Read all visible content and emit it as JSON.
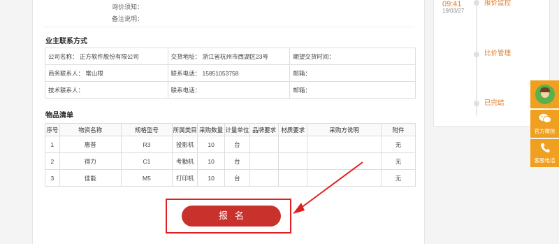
{
  "notes": {
    "price_notice_label": "询价须知：",
    "remark_label": "备注说明："
  },
  "owner_section": {
    "title": "业主联系方式",
    "rows": [
      [
        "公司名称：  正方软件股份有限公司",
        "交货地址：  浙江省杭州市西湖区23号",
        "期望交货时间："
      ],
      [
        "商务联系人：  常山根",
        "联系电话：  15851053758",
        "邮箱："
      ],
      [
        "技术联系人：",
        "联系电话：",
        "邮箱："
      ]
    ]
  },
  "items_section": {
    "title": "物品清单",
    "headers": [
      "序号",
      "物资名称",
      "规格型号",
      "所属类目",
      "采购数量",
      "计量单位",
      "品牌要求",
      "材质要求",
      "采购方说明",
      "附件"
    ],
    "rows": [
      [
        "1",
        "惠普",
        "R3",
        "投影机",
        "10",
        "台",
        "",
        "",
        "",
        "无"
      ],
      [
        "2",
        "得力",
        "C1",
        "考勤机",
        "10",
        "台",
        "",
        "",
        "",
        "无"
      ],
      [
        "3",
        "佳能",
        "M5",
        "打印机",
        "10",
        "台",
        "",
        "",
        "",
        "无"
      ]
    ]
  },
  "signup_button": "报名",
  "timeline": {
    "time": "09:41",
    "date": "19/03/27",
    "steps": [
      "报价监控",
      "比价管理",
      "已完结"
    ]
  },
  "float_bar": {
    "wechat_label": "官方微信",
    "phone_label": "客服电话"
  },
  "colors": {
    "accent": "#e07b2a",
    "button": "#c9322c",
    "highlight_border": "#e02020",
    "float_bar": "#f0a020"
  }
}
